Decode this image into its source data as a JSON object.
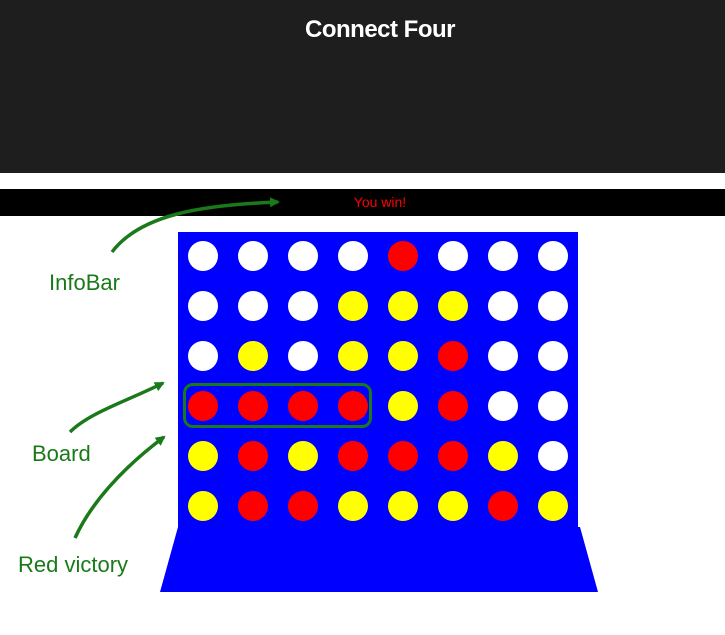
{
  "header": {
    "title": "Connect Four"
  },
  "infobar": {
    "message": "You win!",
    "message_color": "#ff0000"
  },
  "board": {
    "columns": 8,
    "rows": 6,
    "board_color": "#0000ff",
    "cells": [
      [
        "empty",
        "empty",
        "empty",
        "empty",
        "red",
        "empty",
        "empty",
        "empty"
      ],
      [
        "empty",
        "empty",
        "empty",
        "yellow",
        "yellow",
        "yellow",
        "empty",
        "empty"
      ],
      [
        "empty",
        "yellow",
        "empty",
        "yellow",
        "yellow",
        "red",
        "empty",
        "empty"
      ],
      [
        "red",
        "red",
        "red",
        "red",
        "yellow",
        "red",
        "empty",
        "empty"
      ],
      [
        "yellow",
        "red",
        "yellow",
        "red",
        "red",
        "red",
        "yellow",
        "empty"
      ],
      [
        "yellow",
        "red",
        "red",
        "yellow",
        "yellow",
        "yellow",
        "red",
        "yellow"
      ]
    ]
  },
  "annotations": {
    "infobar_label": "InfoBar",
    "board_label": "Board",
    "victory_label": "Red victory",
    "color": "#1a7a1a"
  }
}
